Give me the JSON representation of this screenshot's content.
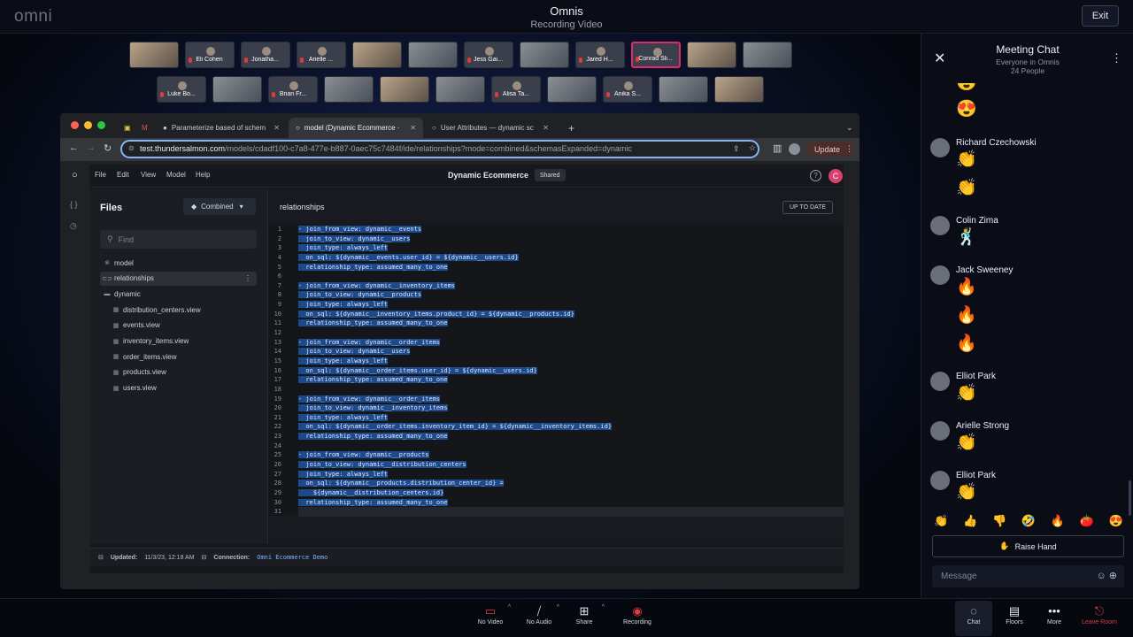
{
  "header": {
    "logo": "omni",
    "title": "Omnis",
    "subtitle": "Recording Video",
    "exit": "Exit"
  },
  "participants_row1": [
    "",
    "Eli Cohen",
    "Jonatha...",
    "Arielle ...",
    "",
    "",
    "Jess Gai...",
    "",
    "Jared H...",
    "Conrad Sli...",
    "",
    ""
  ],
  "participants_row2": [
    "Luke Bo...",
    "",
    "Brian Fr...",
    "",
    "",
    "",
    "Alisa Ta...",
    "",
    "Anika S...",
    "",
    ""
  ],
  "browser": {
    "tabs": [
      "Parameterize based of schem",
      "model (Dynamic Ecommerce ·",
      "User Attributes — dynamic sc"
    ],
    "url_host": "test.thundersalmon.com",
    "url_path": "/models/cdadf100-c7a8-477e-b887-0aec75c7484f/ide/relationships?mode=combined&schemasExpanded=dynamic",
    "update": "Update"
  },
  "app": {
    "menu": [
      "File",
      "Edit",
      "View",
      "Model",
      "Help"
    ],
    "title": "Dynamic Ecommerce",
    "shared": "Shared",
    "avatar": "C",
    "files_title": "Files",
    "mode": "Combined",
    "find_placeholder": "Find",
    "tree": [
      {
        "label": "model",
        "icon": "⊗",
        "sub": false,
        "selected": false
      },
      {
        "label": "relationships",
        "icon": "⊂⊃",
        "sub": false,
        "selected": true
      },
      {
        "label": "dynamic",
        "icon": "▬",
        "sub": false,
        "selected": false
      },
      {
        "label": "distribution_centers.view",
        "icon": "▦",
        "sub": true,
        "selected": false
      },
      {
        "label": "events.view",
        "icon": "▦",
        "sub": true,
        "selected": false
      },
      {
        "label": "inventory_items.view",
        "icon": "▦",
        "sub": true,
        "selected": false
      },
      {
        "label": "order_items.view",
        "icon": "▦",
        "sub": true,
        "selected": false
      },
      {
        "label": "products.view",
        "icon": "▦",
        "sub": true,
        "selected": false
      },
      {
        "label": "users.view",
        "icon": "▦",
        "sub": true,
        "selected": false
      }
    ],
    "editor_title": "relationships",
    "status_badge": "UP TO DATE",
    "code_lines": [
      "- join_from_view: dynamic__events",
      "  join_to_view: dynamic__users",
      "  join_type: always_left",
      "  on_sql: ${dynamic__events.user_id} = ${dynamic__users.id}",
      "  relationship_type: assumed_many_to_one",
      "",
      "- join_from_view: dynamic__inventory_items",
      "  join_to_view: dynamic__products",
      "  join_type: always_left",
      "  on_sql: ${dynamic__inventory_items.product_id} = ${dynamic__products.id}",
      "  relationship_type: assumed_many_to_one",
      "",
      "- join_from_view: dynamic__order_items",
      "  join_to_view: dynamic__users",
      "  join_type: always_left",
      "  on_sql: ${dynamic__order_items.user_id} = ${dynamic__users.id}",
      "  relationship_type: assumed_many_to_one",
      "",
      "- join_from_view: dynamic__order_items",
      "  join_to_view: dynamic__inventory_items",
      "  join_type: always_left",
      "  on_sql: ${dynamic__order_items.inventory_item_id} = ${dynamic__inventory_items.id}",
      "  relationship_type: assumed_many_to_one",
      "",
      "- join_from_view: dynamic__products",
      "  join_to_view: dynamic__distribution_centers",
      "  join_type: always_left",
      "  on_sql: ${dynamic__products.distribution_center_id} =",
      "    ${dynamic__distribution_centers.id}",
      "  relationship_type: assumed_many_to_one",
      ""
    ],
    "status_updated_label": "Updated:",
    "status_updated": "11/3/23, 12:18 AM",
    "status_conn_label": "Connection:",
    "status_conn": "Omni Ecommerce Demo"
  },
  "chat": {
    "title": "Meeting Chat",
    "subtitle": "Everyone in Omnis",
    "count": "24 People",
    "messages": [
      {
        "name": "",
        "emojis": [
          "😍",
          "😍"
        ]
      },
      {
        "name": "Richard Czechowski",
        "emojis": [
          "👏",
          "👏"
        ]
      },
      {
        "name": "Colin Zima",
        "emojis": [
          "🕺"
        ]
      },
      {
        "name": "Jack Sweeney",
        "emojis": [
          "🔥",
          "🔥",
          "🔥"
        ]
      },
      {
        "name": "Elliot Park",
        "emojis": [
          "👏"
        ]
      },
      {
        "name": "Arielle Strong",
        "emojis": [
          "👏"
        ]
      },
      {
        "name": "Elliot Park",
        "emojis": [
          "👏"
        ]
      }
    ],
    "reactions": [
      "👏",
      "👍",
      "👎",
      "🤣",
      "🔥",
      "🍅",
      "😍"
    ],
    "raise_hand": "Raise Hand",
    "message_placeholder": "Message"
  },
  "controls": [
    {
      "label": "No Video",
      "icon": "video-off-icon"
    },
    {
      "label": "No Audio",
      "icon": "mic-off-icon"
    },
    {
      "label": "Share",
      "icon": "share-icon"
    },
    {
      "label": "Recording",
      "icon": "record-icon"
    },
    {
      "label": "Chat",
      "icon": "chat-icon"
    },
    {
      "label": "Floors",
      "icon": "floors-icon"
    },
    {
      "label": "More",
      "icon": "more-icon"
    },
    {
      "label": "Leave Room",
      "icon": "leave-icon"
    }
  ]
}
